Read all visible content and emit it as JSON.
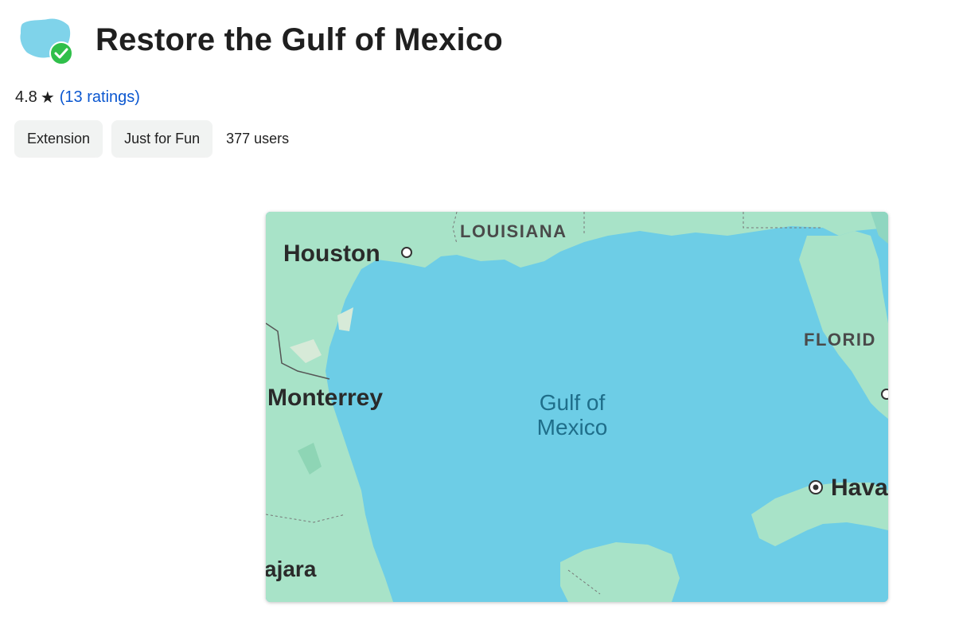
{
  "header": {
    "title": "Restore the Gulf of Mexico",
    "icon": "gulf-map-icon"
  },
  "rating": {
    "value": "4.8",
    "star": "★",
    "count_label": "13 ratings",
    "open_paren": "(",
    "close_paren": ")"
  },
  "chips": {
    "type_label": "Extension",
    "category_label": "Just for Fun",
    "users_label": "377 users"
  },
  "screenshot": {
    "labels": {
      "louisiana": "LOUISIANA",
      "houston": "Houston",
      "florida": "FLORID",
      "monterrey": "Monterrey",
      "gulf_line1": "Gulf of",
      "gulf_line2": "Mexico",
      "havana": "Hava",
      "guadalajara": "ajara"
    }
  },
  "colors": {
    "water": "#6dcde6",
    "land": "#a8e3c8",
    "link": "#0b57d0",
    "check_badge": "#2fbf4a"
  }
}
